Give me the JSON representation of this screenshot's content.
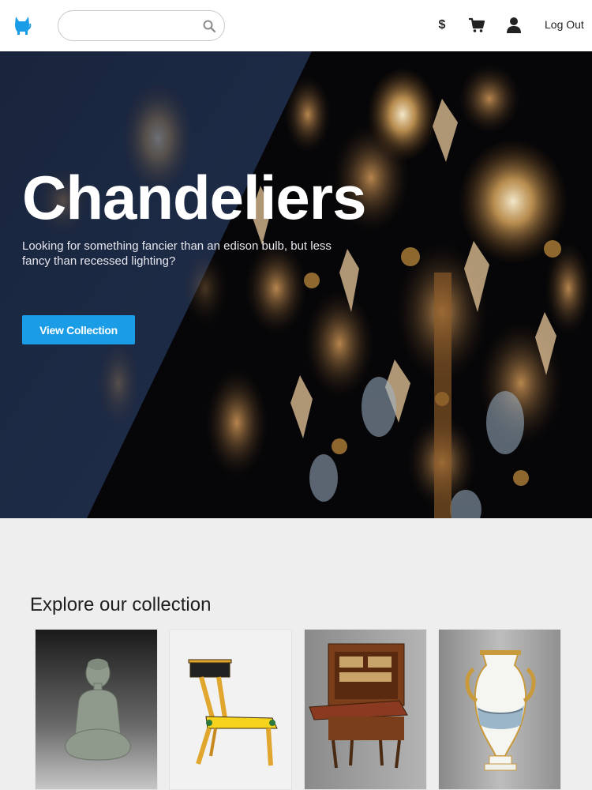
{
  "header": {
    "search": {
      "value": "",
      "placeholder": ""
    },
    "nav": {
      "dollar_label": "$",
      "logout_label": "Log Out"
    },
    "icons": [
      "cat-logo-icon",
      "search-icon",
      "dollar-icon",
      "cart-icon",
      "user-icon"
    ]
  },
  "hero": {
    "title": "Chandeliers",
    "subtitle": "Looking for something fancier than an edison bulb, but less fancy than recessed lighting?",
    "button_label": "View Collection"
  },
  "collection": {
    "title": "Explore our collection",
    "items": [
      {
        "subject": "jade buddha statue"
      },
      {
        "subject": "painted yellow chair"
      },
      {
        "subject": "wooden secretary desk"
      },
      {
        "subject": "porcelain vase"
      }
    ]
  },
  "colors": {
    "accent": "#1a9de6",
    "logo": "#1a9de6",
    "background": "#eeeeee",
    "header_bg": "#ffffff"
  }
}
